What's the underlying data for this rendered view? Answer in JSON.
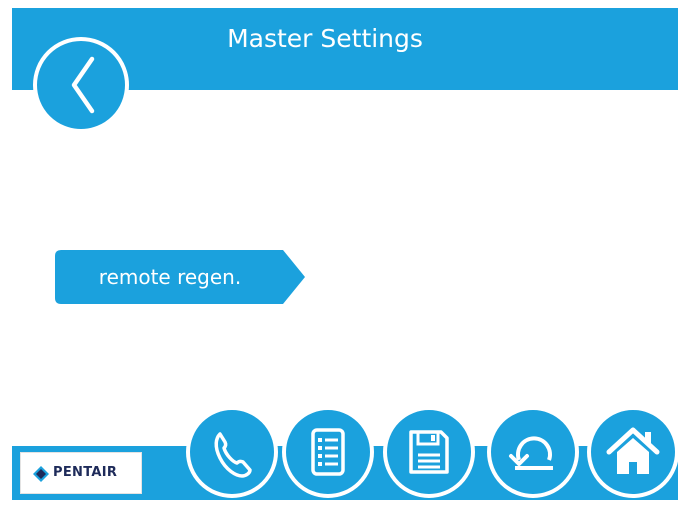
{
  "header": {
    "title": "Master Settings",
    "back_icon": "chevron-left-icon"
  },
  "main": {
    "actions": [
      {
        "label": "remote regen."
      }
    ]
  },
  "footer": {
    "logo_text": "PENTAIR",
    "nav_buttons": [
      {
        "icon": "phone-icon"
      },
      {
        "icon": "list-icon"
      },
      {
        "icon": "save-icon"
      },
      {
        "icon": "undo-icon"
      },
      {
        "icon": "home-icon"
      }
    ]
  },
  "colors": {
    "accent": "#1ba1dd",
    "background": "#ffffff",
    "logo_navy": "#1e2b5a"
  }
}
